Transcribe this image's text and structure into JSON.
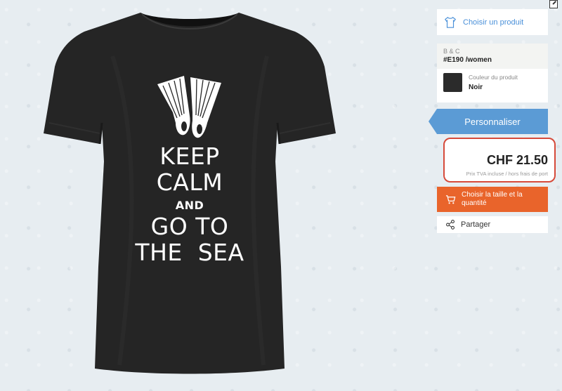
{
  "product_image": {
    "alt_icon": "tshirt-black-icon",
    "print_lines": [
      "KEEP",
      "CALM",
      "AND",
      "GO TO",
      "THE  SEA"
    ],
    "print_icon": "swim-fins-icon"
  },
  "sidebar": {
    "choose_product_label": "Choisir un produit",
    "brand": "B & C",
    "sku": "#E190 /women",
    "color_label": "Couleur du produit",
    "color_value": "Noir",
    "color_swatch": "#2b2b2b",
    "personalize_label": "Personnaliser",
    "price": "CHF 21.50",
    "price_note": "Prix TVA incluse / hors frais de port",
    "size_button_label": "Choisir la taille et la quantité",
    "share_label": "Partager"
  },
  "colors": {
    "accent_blue": "#5b9bd5",
    "link_blue": "#4a90d9",
    "cta_orange": "#e9642b",
    "highlight_red": "#d64a3a"
  }
}
